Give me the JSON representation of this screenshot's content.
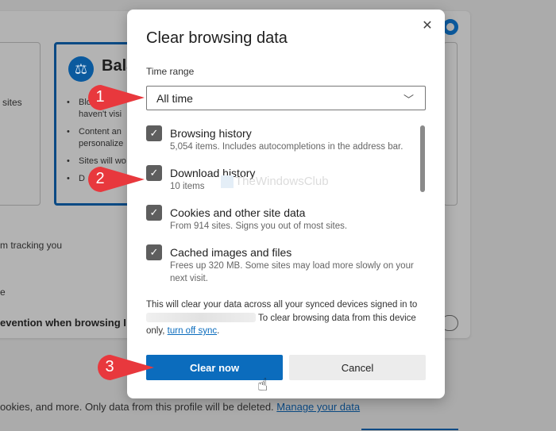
{
  "background": {
    "left_option_text": "sites",
    "balanced_title": "Bala",
    "balanced_icon": "scale-icon",
    "balanced_bullets": [
      "Blo",
      "haven't visi",
      "Content an",
      "personalize",
      "Sites will wo",
      "D"
    ],
    "tracking_text": "m tracking you",
    "fragment_e": "e",
    "strict_prevention_text": "evention when browsing I",
    "bottom_text": "ookies, and more. Only data from this profile will be deleted.",
    "manage_link": "Manage your data"
  },
  "dialog": {
    "title": "Clear browsing data",
    "close_icon": "close-icon",
    "time_range": {
      "label": "Time range",
      "value": "All time"
    },
    "items": [
      {
        "title": "Browsing history",
        "description": "5,054 items. Includes autocompletions in the address bar.",
        "checked": true
      },
      {
        "title": "Download history",
        "description": "10 items",
        "checked": true
      },
      {
        "title": "Cookies and other site data",
        "description": "From 914 sites. Signs you out of most sites.",
        "checked": true
      },
      {
        "title": "Cached images and files",
        "description": "Frees up 320 MB. Some sites may load more slowly on your next visit.",
        "checked": true
      }
    ],
    "sync_note_1": "This will clear your data across all your synced devices signed in to",
    "sync_note_2": "To clear browsing data from this device only,",
    "sync_link": "turn off sync",
    "sync_note_end": ".",
    "clear_button": "Clear now",
    "cancel_button": "Cancel"
  },
  "watermark": "TheWindowsClub",
  "markers": [
    "1",
    "2",
    "3"
  ],
  "colors": {
    "accent": "#0b6cbd",
    "marker": "#e8383d",
    "checkbox": "#5e5e5e"
  }
}
